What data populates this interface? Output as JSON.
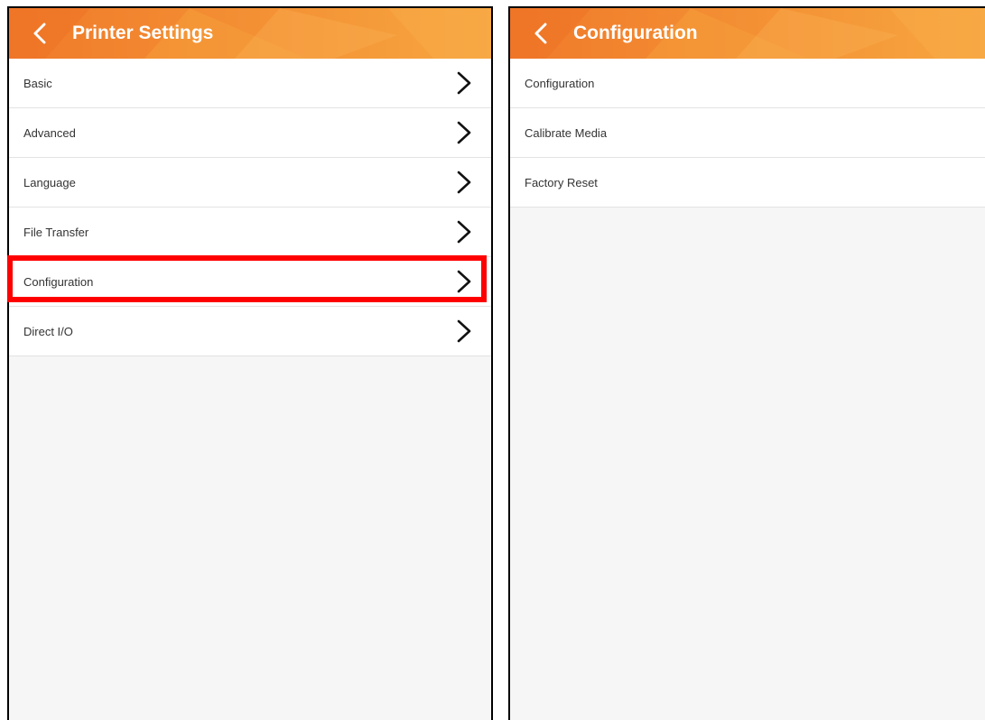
{
  "left_screen": {
    "title": "Printer Settings",
    "items": [
      {
        "label": "Basic"
      },
      {
        "label": "Advanced"
      },
      {
        "label": "Language"
      },
      {
        "label": "File Transfer"
      },
      {
        "label": "Configuration"
      },
      {
        "label": "Direct I/O"
      }
    ],
    "highlighted_item": "Configuration",
    "row_icon": "chevron-right-icon"
  },
  "right_screen": {
    "title": "Configuration",
    "items": [
      {
        "label": "Configuration"
      },
      {
        "label": "Calibrate Media"
      },
      {
        "label": "Factory Reset"
      }
    ]
  },
  "colors": {
    "appbar_start": "#f07a2a",
    "appbar_end": "#f7a640",
    "highlight": "#ff0000",
    "background": "#f6f6f6"
  }
}
